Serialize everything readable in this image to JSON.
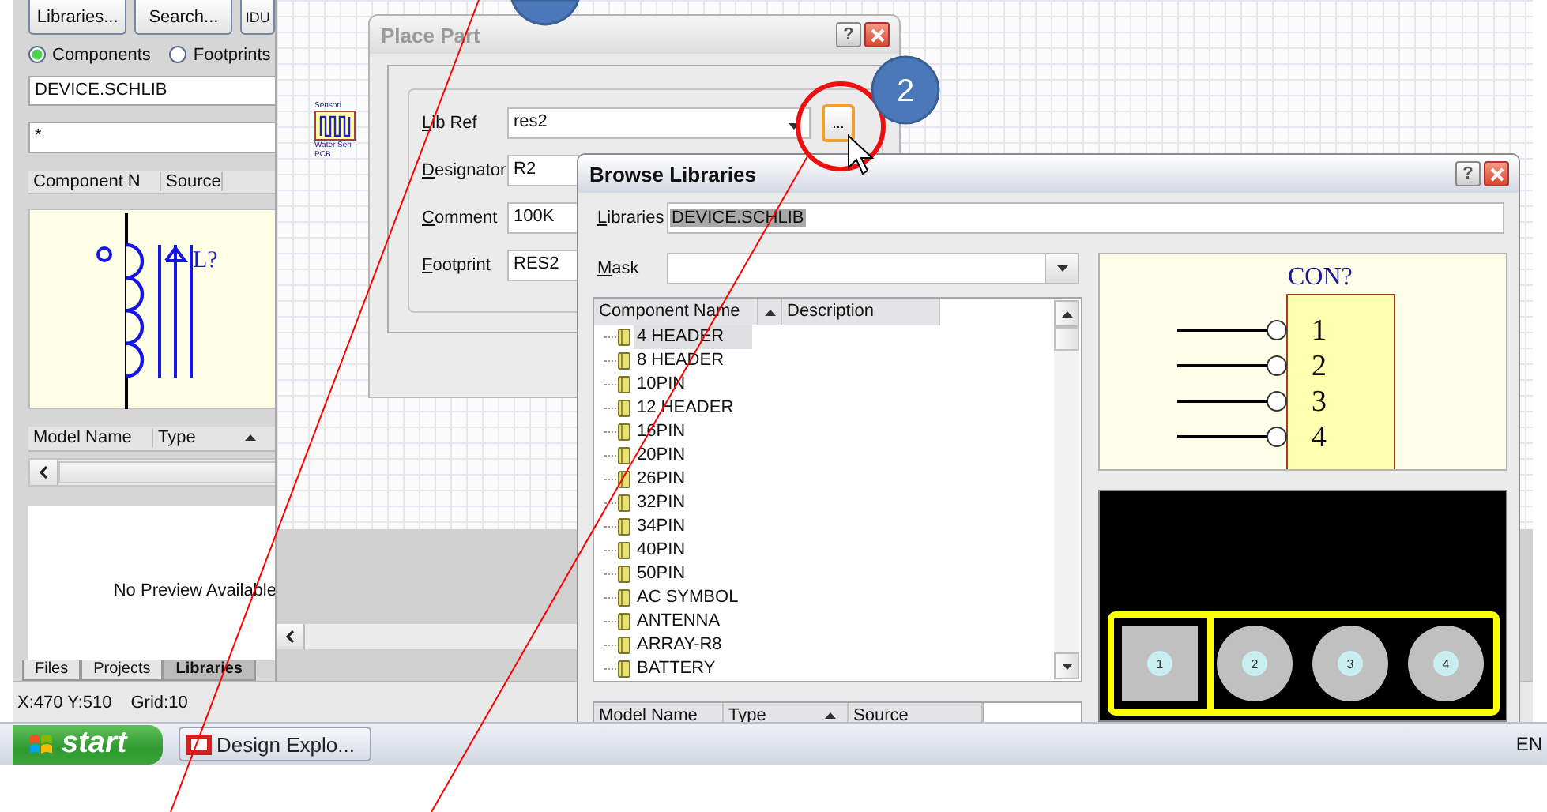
{
  "app": {
    "panel_buttons": [
      "Libraries...",
      "Search...",
      "IDU"
    ],
    "view_options": [
      {
        "label": "Components",
        "selected": true
      },
      {
        "label": "Footprints",
        "selected": false
      }
    ],
    "library_field": "DEVICE.SCHLIB",
    "filter_field": "*",
    "component_columns": [
      "Component N",
      "Source"
    ],
    "symbol_preview": {
      "designator": "L?"
    },
    "model_columns": [
      "Model Name",
      "Type"
    ],
    "footprint_preview": "No Preview Available",
    "panel_tabs": [
      {
        "label": "Files",
        "selected": false
      },
      {
        "label": "Projects",
        "selected": false
      },
      {
        "label": "Libraries",
        "selected": true
      }
    ],
    "canvas_part": {
      "labels": [
        "Sensori",
        "Water Sen",
        "PCB"
      ]
    },
    "status_bar": [
      "X:470 Y:510",
      "Grid:10"
    ]
  },
  "place_part": {
    "title": "Place Part",
    "help_button": "?",
    "browse_button": "...",
    "fields": [
      {
        "label": "Lib Ref",
        "value": "res2",
        "kind": "combo"
      },
      {
        "label": "Designator",
        "value": "R2",
        "kind": "text"
      },
      {
        "label": "Comment",
        "value": "100K",
        "kind": "text"
      },
      {
        "label": "Footprint",
        "value": "RES2",
        "kind": "text"
      }
    ]
  },
  "browse_libraries": {
    "title": "Browse Libraries",
    "help_button": "?",
    "libraries_label": "Libraries",
    "libraries": "DEVICE.SCHLIB",
    "mask_label": "Mask",
    "columns": [
      "Component Name",
      "Description"
    ],
    "components": [
      {
        "name": "4 HEADER",
        "selected": true
      },
      {
        "name": "8 HEADER",
        "selected": false
      },
      {
        "name": "10PIN",
        "selected": false
      },
      {
        "name": "12 HEADER",
        "selected": false
      },
      {
        "name": "16PIN",
        "selected": false
      },
      {
        "name": "20PIN",
        "selected": false
      },
      {
        "name": "26PIN",
        "selected": false
      },
      {
        "name": "32PIN",
        "selected": false
      },
      {
        "name": "34PIN",
        "selected": false
      },
      {
        "name": "40PIN",
        "selected": false
      },
      {
        "name": "50PIN",
        "selected": false
      },
      {
        "name": "AC SYMBOL",
        "selected": false
      },
      {
        "name": "ANTENNA",
        "selected": false
      },
      {
        "name": "ARRAY-R8",
        "selected": false
      },
      {
        "name": "BATTERY",
        "selected": false
      }
    ],
    "model_columns": [
      "Model Name",
      "Type",
      "Source"
    ],
    "symbol_preview": {
      "designator": "CON?",
      "pins": [
        "1",
        "2",
        "3",
        "4"
      ]
    },
    "footprint_preview": {
      "pads": [
        {
          "label": "1",
          "kind": "square"
        },
        {
          "label": "2",
          "kind": "round"
        },
        {
          "label": "3",
          "kind": "round"
        },
        {
          "label": "4",
          "kind": "round"
        }
      ]
    }
  },
  "taskbar": {
    "start": "start",
    "tasks": [
      {
        "label": "Design Explo..."
      }
    ],
    "tray": "EN"
  },
  "annotations": [
    {
      "kind": "partial"
    },
    {
      "kind": "numbered",
      "number": "2"
    }
  ]
}
